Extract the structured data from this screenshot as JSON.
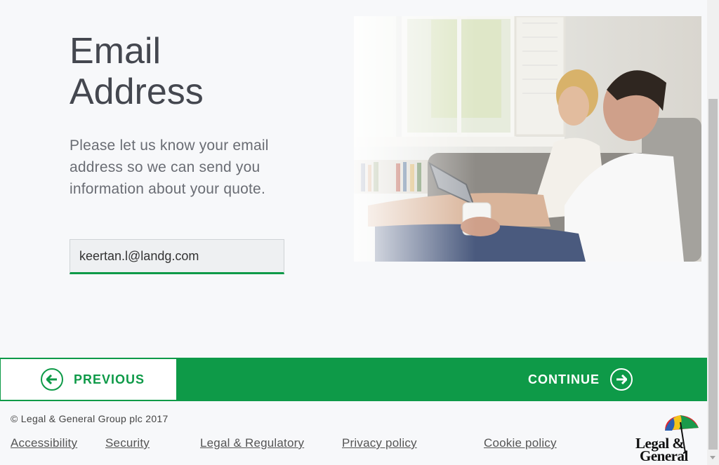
{
  "page": {
    "title_line1": "Email",
    "title_line2": "Address",
    "intro": "Please let us know your email address so we can send you information about your quote."
  },
  "form": {
    "email_value": "keertan.l@landg.com"
  },
  "nav": {
    "previous_label": "PREVIOUS",
    "continue_label": "CONTINUE"
  },
  "footer": {
    "copyright": "© Legal & General Group plc 2017",
    "links": [
      "Accessibility",
      "Security",
      "Legal & Regulatory",
      "Privacy policy",
      "Cookie policy"
    ],
    "logo_line1": "Legal &",
    "logo_line2": "General"
  },
  "colors": {
    "brand_green": "#0e9a48",
    "title_text": "#44474f",
    "body_text": "#6a6d74"
  },
  "icons": {
    "previous": "arrow-left-circle-icon",
    "continue": "arrow-right-circle-icon",
    "logo": "umbrella-icon"
  }
}
